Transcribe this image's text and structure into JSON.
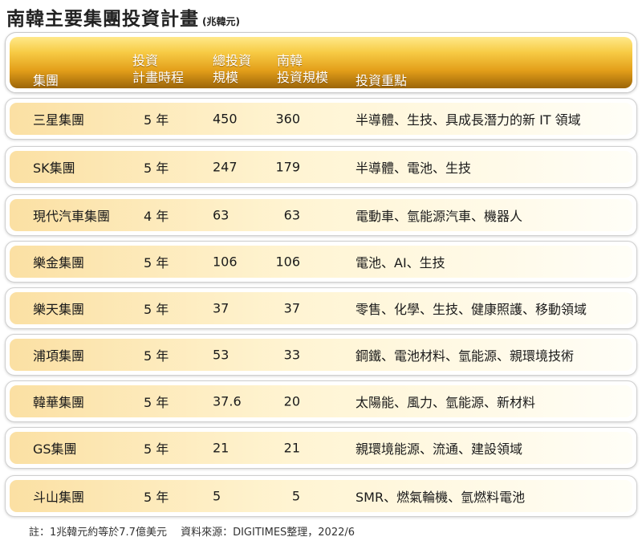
{
  "title": "南韓主要集團投資計畫",
  "unit": "(兆韓元)",
  "header": {
    "group": "集團",
    "period_l1": "投資",
    "period_l2": "計畫時程",
    "total_l1": "總投資",
    "total_l2": "規模",
    "korea_l1": "南韓",
    "korea_l2": "投資規模",
    "focus": "投資重點"
  },
  "rows": [
    {
      "group": "三星集團",
      "period": "5 年",
      "total": "450",
      "korea": "360",
      "focus": "半導體、生技、具成長潛力的新 IT 領域"
    },
    {
      "group": "SK集團",
      "period": "5 年",
      "total": "247",
      "korea": "179",
      "focus": "半導體、電池、生技"
    },
    {
      "group": "現代汽車集團",
      "period": "4 年",
      "total": "63",
      "korea": "63",
      "focus": "電動車、氫能源汽車、機器人"
    },
    {
      "group": "樂金集團",
      "period": "5 年",
      "total": "106",
      "korea": "106",
      "focus": "電池、AI、生技"
    },
    {
      "group": "樂天集團",
      "period": "5 年",
      "total": "37",
      "korea": "37",
      "focus": "零售、化學、生技、健康照護、移動領域"
    },
    {
      "group": "浦項集團",
      "period": "5 年",
      "total": "53",
      "korea": "33",
      "focus": "鋼鐵、電池材料、氫能源、親環境技術"
    },
    {
      "group": "韓華集團",
      "period": "5 年",
      "total": "37.6",
      "korea": "20",
      "focus": "太陽能、風力、氫能源、新材料"
    },
    {
      "group": "GS集團",
      "period": "5 年",
      "total": "21",
      "korea": "21",
      "focus": "親環境能源、流通、建設領域"
    },
    {
      "group": "斗山集團",
      "period": "5 年",
      "total": "5",
      "korea": "5",
      "focus": "SMR、燃氣輪機、氫燃料電池"
    }
  ],
  "footnote": "註：1兆韓元約等於7.7億美元　 資料來源：DIGITIMES整理，2022/6"
}
